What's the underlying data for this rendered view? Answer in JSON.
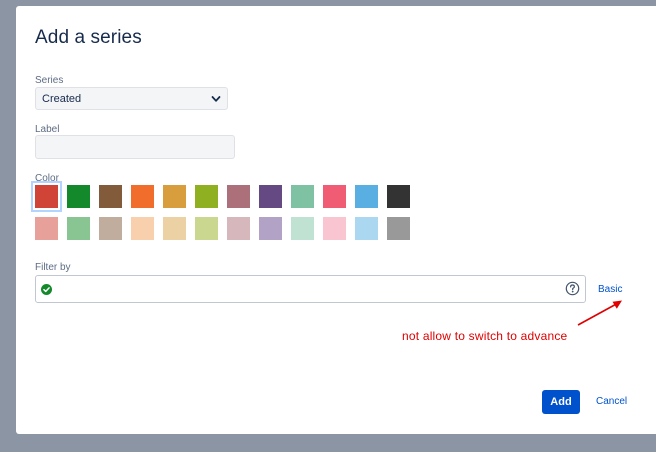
{
  "dialog": {
    "title": "Add a series"
  },
  "series": {
    "label": "Series",
    "selected": "Created"
  },
  "label_field": {
    "label": "Label",
    "value": ""
  },
  "color": {
    "label": "Color",
    "selected_index": 0,
    "rows": [
      [
        "#d04437",
        "#14892c",
        "#815b3a",
        "#f06d2c",
        "#d89e3d",
        "#8eb021",
        "#ac707a",
        "#654982",
        "#7fc1a3",
        "#f15c75",
        "#59afe1",
        "#333333"
      ],
      [
        "#e7a09a",
        "#89c493",
        "#c1ad9d",
        "#f8d0ad",
        "#ebd1a4",
        "#c9d88e",
        "#d5b7bc",
        "#b2a2c5",
        "#c0e2d3",
        "#f8c5d1",
        "#acd7f1",
        "#999999"
      ]
    ]
  },
  "filter": {
    "label": "Filter by",
    "value": "",
    "check_icon": "check-circle-icon",
    "help_icon": "help-icon",
    "mode_link": "Basic"
  },
  "annotation": {
    "text": "not allow to switch to advance",
    "color": "#e00000"
  },
  "actions": {
    "add_label": "Add",
    "cancel_label": "Cancel"
  }
}
